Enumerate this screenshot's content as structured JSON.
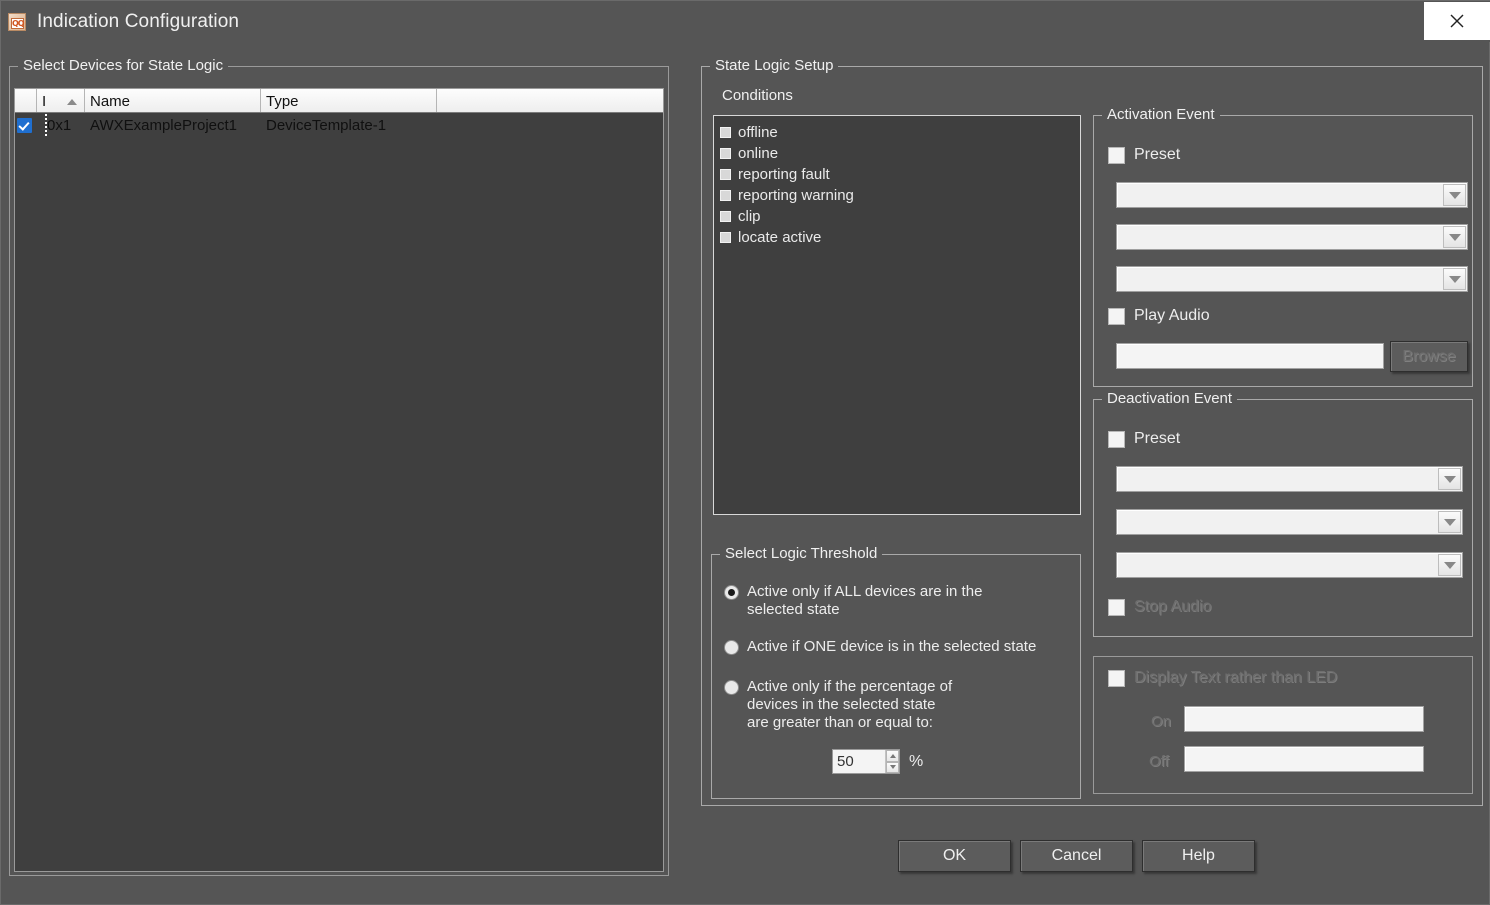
{
  "window": {
    "title": "Indication Configuration",
    "icon": "app-cube-icon",
    "close_label": "×"
  },
  "devices_panel": {
    "title": "Select Devices for State Logic",
    "columns": [
      "",
      "I",
      "Name",
      "Type",
      ""
    ],
    "rows": [
      {
        "checked": true,
        "id": "0x1",
        "name": "AWXExampleProject1",
        "type": "DeviceTemplate-1",
        "extra": ""
      }
    ],
    "sort_column": "I",
    "sort_direction": "ascending"
  },
  "state_logic": {
    "title": "State Logic Setup",
    "conditions_label": "Conditions",
    "conditions": [
      {
        "label": "offline",
        "checked": false
      },
      {
        "label": "online",
        "checked": false
      },
      {
        "label": "reporting fault",
        "checked": false
      },
      {
        "label": "reporting warning",
        "checked": false
      },
      {
        "label": "clip",
        "checked": false
      },
      {
        "label": "locate active",
        "checked": false
      }
    ]
  },
  "threshold": {
    "title": "Select Logic Threshold",
    "options": [
      {
        "label": "Active only if ALL devices are in the\nselected state",
        "selected": true
      },
      {
        "label": "Active if ONE device is in the selected state",
        "selected": false
      },
      {
        "label": "Active only if the percentage of\ndevices in the selected state\nare greater than or equal to:",
        "selected": false
      }
    ],
    "percent_value": "50",
    "percent_unit": "%"
  },
  "activation": {
    "title": "Activation Event",
    "preset_label": "Preset",
    "preset_checked": false,
    "combos": [
      {
        "value": "",
        "name": "activation-combo-1"
      },
      {
        "value": "",
        "name": "activation-combo-2"
      },
      {
        "value": "",
        "name": "activation-combo-3"
      }
    ],
    "play_audio_label": "Play Audio",
    "play_audio_checked": false,
    "audio_path": "",
    "browse_label": "Browse",
    "browse_disabled": true
  },
  "deactivation": {
    "title": "Deactivation Event",
    "preset_label": "Preset",
    "preset_checked": false,
    "combos": [
      {
        "value": "",
        "name": "deactivation-combo-1"
      },
      {
        "value": "",
        "name": "deactivation-combo-2"
      },
      {
        "value": "",
        "name": "deactivation-combo-3"
      }
    ],
    "stop_audio_label": "Stop Audio",
    "stop_audio_checked": false,
    "stop_audio_disabled": true
  },
  "display_text": {
    "checkbox_label": "Display Text rather than LED",
    "checked": false,
    "disabled": true,
    "on_label": "On",
    "on_value": "",
    "off_label": "Off",
    "off_value": ""
  },
  "footer": {
    "ok_label": "OK",
    "cancel_label": "Cancel",
    "help_label": "Help"
  },
  "colors": {
    "dialog_bg": "#555555",
    "list_bg": "#3f3f3f",
    "accent_check": "#1f6fd0",
    "field_bg": "#f4f4f4",
    "text": "#ededed",
    "disabled_text": "#6e6e6e"
  }
}
